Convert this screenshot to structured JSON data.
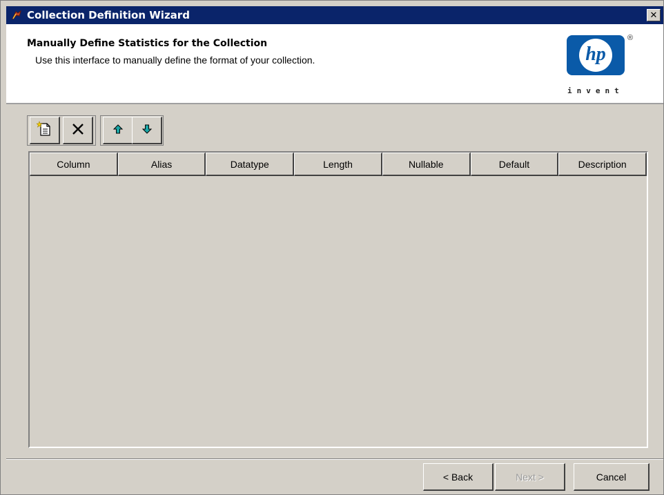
{
  "window": {
    "title": "Collection Definition Wizard",
    "close_glyph": "✕"
  },
  "header": {
    "title": "Manually Define Statistics for the Collection",
    "subtitle": "Use this interface to manually define the format of your collection.",
    "logo": {
      "mark": "hp",
      "registered": "®",
      "tagline": "invent",
      "color": "#0a5aa8"
    }
  },
  "toolbar": {
    "buttons": [
      {
        "name": "new-row",
        "icon": "new-document-icon"
      },
      {
        "name": "delete-row",
        "icon": "delete-x-icon"
      },
      {
        "name": "move-up",
        "icon": "arrow-up-icon"
      },
      {
        "name": "move-down",
        "icon": "arrow-down-icon"
      }
    ]
  },
  "table": {
    "columns": [
      "Column",
      "Alias",
      "Datatype",
      "Length",
      "Nullable",
      "Default",
      "Description"
    ],
    "rows": []
  },
  "footer": {
    "back_label": "< Back",
    "next_label": "Next >",
    "cancel_label": "Cancel"
  },
  "colors": {
    "titlebar": "#0a246a",
    "dialog": "#d4d0c8",
    "arrow": "#1aa6a6"
  }
}
